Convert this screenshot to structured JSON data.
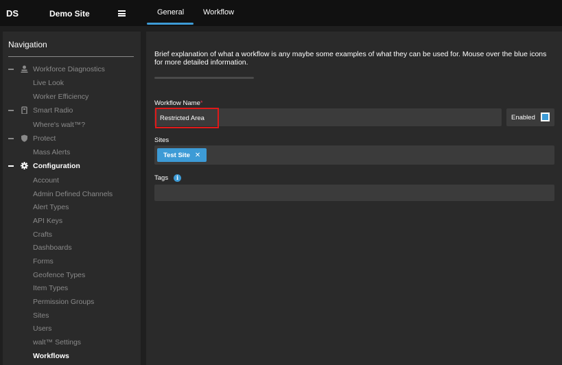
{
  "brand": {
    "abbr": "DS",
    "site_name": "Demo Site"
  },
  "tabs": [
    {
      "label": "General",
      "active": true
    },
    {
      "label": "Workflow",
      "active": false
    }
  ],
  "sidebar": {
    "title": "Navigation",
    "sections": [
      {
        "label": "Workforce Diagnostics",
        "icon": "person-icon",
        "children": [
          "Live Look",
          "Worker Efficiency"
        ]
      },
      {
        "label": "Smart Radio",
        "icon": "radio-icon",
        "children": [
          "Where's walt™?"
        ]
      },
      {
        "label": "Protect",
        "icon": "shield-icon",
        "children": [
          "Mass Alerts"
        ]
      },
      {
        "label": "Configuration",
        "icon": "gear-icon",
        "active": true,
        "children": [
          "Account",
          "Admin Defined Channels",
          "Alert Types",
          "API Keys",
          "Crafts",
          "Dashboards",
          "Forms",
          "Geofence Types",
          "Item Types",
          "Permission Groups",
          "Sites",
          "Users",
          "walt™ Settings",
          "Workflows"
        ],
        "active_child": "Workflows"
      }
    ]
  },
  "main": {
    "intro": "Brief explanation of what a workflow is any maybe some examples of what they can be used for. Mouse over the blue icons for more detailed information.",
    "workflow_name": {
      "label": "Workflow Name",
      "required_mark": "*",
      "value": "Restricted Area"
    },
    "enabled": {
      "label": "Enabled",
      "checked": true
    },
    "sites": {
      "label": "Sites",
      "chips": [
        "Test Site"
      ],
      "chip_remove": "✕"
    },
    "tags": {
      "label": "Tags",
      "info": "i",
      "value": ""
    }
  },
  "colors": {
    "accent": "#3d9bd6",
    "highlight": "#e01919",
    "required": "#e0334a"
  }
}
